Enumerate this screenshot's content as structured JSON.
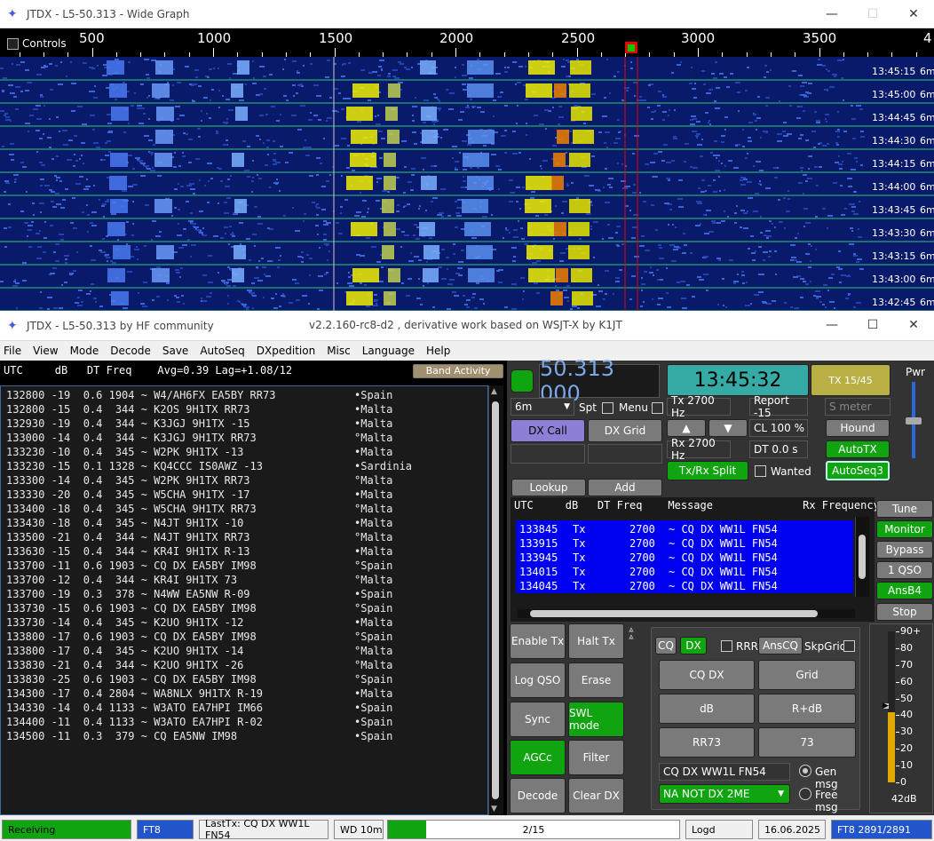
{
  "wide_graph": {
    "title": "JTDX - L5-50.313 - Wide Graph",
    "controls_label": "Controls",
    "scale_labels": [
      "500",
      "1000",
      "1500",
      "2000",
      "2500",
      "3000",
      "3500",
      "4"
    ],
    "timestamps": [
      "13:45:15",
      "13:45:00",
      "13:44:45",
      "13:44:30",
      "13:44:15",
      "13:44:00",
      "13:43:45",
      "13:43:30",
      "13:43:15",
      "13:43:00",
      "13:42:45"
    ],
    "band": "6m"
  },
  "main": {
    "title": "JTDX - L5-50.313  by HF community",
    "version": "v2.2.160-rc8-d2 , derivative work based on WSJT-X by K1JT",
    "menu": [
      "File",
      "View",
      "Mode",
      "Decode",
      "Save",
      "AutoSeq",
      "DXpedition",
      "Misc",
      "Language",
      "Help"
    ]
  },
  "band_activity": {
    "header": "UTC     dB   DT Freq    Avg=0.39 Lag=+1.08/12",
    "button": "Band Activity",
    "rows": [
      {
        "t": "132800 -19  0.6 1904 ~ W4/AH6FX EA5BY RR73",
        "c": "•Spain"
      },
      {
        "t": "132800 -15  0.4  344 ~ K2OS 9H1TX RR73",
        "c": "•Malta"
      },
      {
        "t": "132930 -19  0.4  344 ~ K3JGJ 9H1TX -15",
        "c": "•Malta"
      },
      {
        "t": "133000 -14  0.4  344 ~ K3JGJ 9H1TX RR73",
        "c": "°Malta"
      },
      {
        "t": "133230 -10  0.4  345 ~ W2PK 9H1TX -13",
        "c": "•Malta"
      },
      {
        "t": "133230 -15  0.1 1328 ~ KQ4CCC IS0AWZ -13",
        "c": "•Sardinia"
      },
      {
        "t": "133300 -14  0.4  345 ~ W2PK 9H1TX RR73",
        "c": "°Malta"
      },
      {
        "t": "133330 -20  0.4  345 ~ W5CHA 9H1TX -17",
        "c": "•Malta"
      },
      {
        "t": "133400 -18  0.4  345 ~ W5CHA 9H1TX RR73",
        "c": "°Malta"
      },
      {
        "t": "133430 -18  0.4  345 ~ N4JT 9H1TX -10",
        "c": "•Malta"
      },
      {
        "t": "133500 -21  0.4  344 ~ N4JT 9H1TX RR73",
        "c": "°Malta"
      },
      {
        "t": "133630 -15  0.4  344 ~ KR4I 9H1TX R-13",
        "c": "•Malta"
      },
      {
        "t": "133700 -11  0.6 1903 ~ CQ DX EA5BY IM98",
        "c": "°Spain"
      },
      {
        "t": "133700 -12  0.4  344 ~ KR4I 9H1TX 73",
        "c": "°Malta"
      },
      {
        "t": "133700 -19  0.3  378 ~ N4WW EA5NW R-09",
        "c": "•Spain"
      },
      {
        "t": "133730 -15  0.6 1903 ~ CQ DX EA5BY IM98",
        "c": "°Spain"
      },
      {
        "t": "133730 -14  0.4  345 ~ K2UO 9H1TX -12",
        "c": "•Malta"
      },
      {
        "t": "133800 -17  0.6 1903 ~ CQ DX EA5BY IM98",
        "c": "°Spain"
      },
      {
        "t": "133800 -17  0.4  345 ~ K2UO 9H1TX -14",
        "c": "°Malta"
      },
      {
        "t": "133830 -21  0.4  344 ~ K2UO 9H1TX -26",
        "c": "°Malta"
      },
      {
        "t": "133830 -25  0.6 1903 ~ CQ DX EA5BY IM98",
        "c": "°Spain"
      },
      {
        "t": "134300 -17  0.4 2804 ~ WA8NLX 9H1TX R-19",
        "c": "•Malta"
      },
      {
        "t": "134330 -14  0.4 1133 ~ W3ATO EA7HPI IM66",
        "c": "•Spain"
      },
      {
        "t": "134400 -11  0.4 1133 ~ W3ATO EA7HPI R-02",
        "c": "•Spain"
      },
      {
        "t": "134500 -11  0.3  379 ~ CQ EA5NW IM98",
        "c": "•Spain"
      }
    ]
  },
  "controls": {
    "frequency": "50.313 000",
    "clock": "13:45:32",
    "tx_period": "TX 15/45",
    "pwr_label": "Pwr",
    "band_select": "6m",
    "spt_label": "Spt",
    "menu_label": "Menu",
    "tx_freq": "Tx 2700 Hz",
    "report": "Report -15",
    "s_meter": "S meter",
    "rx_freq": "Rx 2700 Hz",
    "cl": "CL 100 %",
    "hound": "Hound",
    "dt": "DT 0.0 s",
    "autotx": "AutoTX",
    "dx_call": "DX Call",
    "dx_grid": "DX Grid",
    "txrx_split": "Tx/Rx Split",
    "wanted": "Wanted",
    "autoseq3": "AutoSeq3",
    "lookup": "Lookup",
    "add": "Add"
  },
  "rx_freq": {
    "header": "UTC     dB   DT Freq    Message              Rx Frequency",
    "rows": [
      {
        "utc": "133845",
        "tx": "Tx",
        "freq": "2700",
        "msg": "~ CQ DX WW1L FN54"
      },
      {
        "utc": "133915",
        "tx": "Tx",
        "freq": "2700",
        "msg": "~ CQ DX WW1L FN54"
      },
      {
        "utc": "133945",
        "tx": "Tx",
        "freq": "2700",
        "msg": "~ CQ DX WW1L FN54"
      },
      {
        "utc": "134015",
        "tx": "Tx",
        "freq": "2700",
        "msg": "~ CQ DX WW1L FN54"
      },
      {
        "utc": "134045",
        "tx": "Tx",
        "freq": "2700",
        "msg": "~ CQ DX WW1L FN54"
      }
    ]
  },
  "side_buttons": [
    "Tune",
    "Monitor",
    "Bypass",
    "1 QSO",
    "AnsB4",
    "Stop"
  ],
  "tx_buttons": {
    "enable_tx": "Enable Tx",
    "halt_tx": "Halt Tx",
    "log_qso": "Log QSO",
    "erase": "Erase",
    "sync": "Sync",
    "swl_mode": "SWL mode",
    "agcc": "AGCc",
    "filter": "Filter",
    "decode": "Decode",
    "clear_dx": "Clear DX"
  },
  "gen": {
    "cq": "CQ",
    "dx": "DX",
    "rrr": "RRR",
    "anscq": "AnsCQ",
    "skpgrid": "SkpGrid",
    "cq_dx": "CQ DX",
    "grid": "Grid",
    "db": "dB",
    "r_db": "R+dB",
    "rr73": "RR73",
    "n73": "73",
    "message": "CQ DX WW1L FN54",
    "gen_msg": "Gen msg",
    "free_msg": "Free msg",
    "select": "NA NOT DX 2ME"
  },
  "meter": {
    "labels": [
      "90+",
      "80",
      "70",
      "60",
      "50",
      "40",
      "30",
      "20",
      "10",
      "0"
    ],
    "reading": "42dB",
    "level_db": 42
  },
  "status": {
    "receiving": "Receiving",
    "mode": "FT8",
    "last_tx": "LastTx: CQ DX WW1L FN54",
    "wd": "WD 10m",
    "progress": "2/15",
    "progress_fraction": 0.13,
    "logd": "Logd",
    "date": "16.06.2025",
    "count": "FT8  2891/2891"
  }
}
